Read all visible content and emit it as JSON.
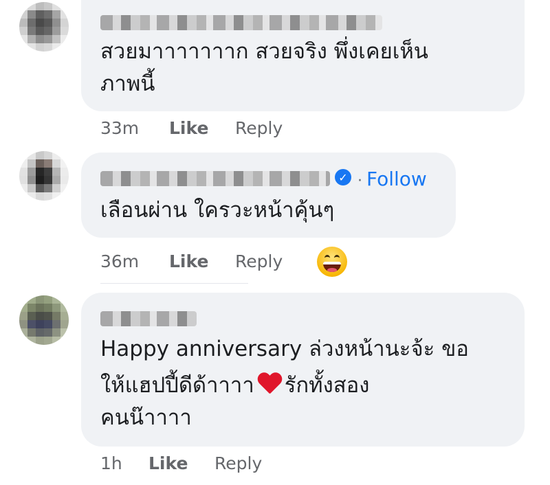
{
  "comments": [
    {
      "text_lines": [
        "สวยมาาาาาาาก สวยจริง พึ่งเคยเห็น",
        "ภาพนี้"
      ],
      "time": "33m",
      "like_label": "Like",
      "reply_label": "Reply"
    },
    {
      "text_lines": [
        "เลือนผ่าน ใครวะหน้าคุ้นๆ"
      ],
      "follow_separator": "·",
      "follow_label": "Follow",
      "time": "36m",
      "like_label": "Like",
      "reply_label": "Reply",
      "reaction_icon": "grinning-face-emoji-icon"
    },
    {
      "text_lines": [
        "Happy anniversary ล่วงหน้านะจ้ะ ขอ",
        "ให้แฮปปี้ดีด้าาาา",
        "รักทั้งสอง",
        "คนน๊าาาา"
      ],
      "inline_icon": "red-heart-emoji-icon",
      "time": "1h",
      "like_label": "Like",
      "reply_label": "Reply"
    }
  ],
  "colors": {
    "bubble_bg": "#f0f2f5",
    "meta_text": "#65676b",
    "link_blue": "#1877f2",
    "text": "#1c1e21"
  }
}
